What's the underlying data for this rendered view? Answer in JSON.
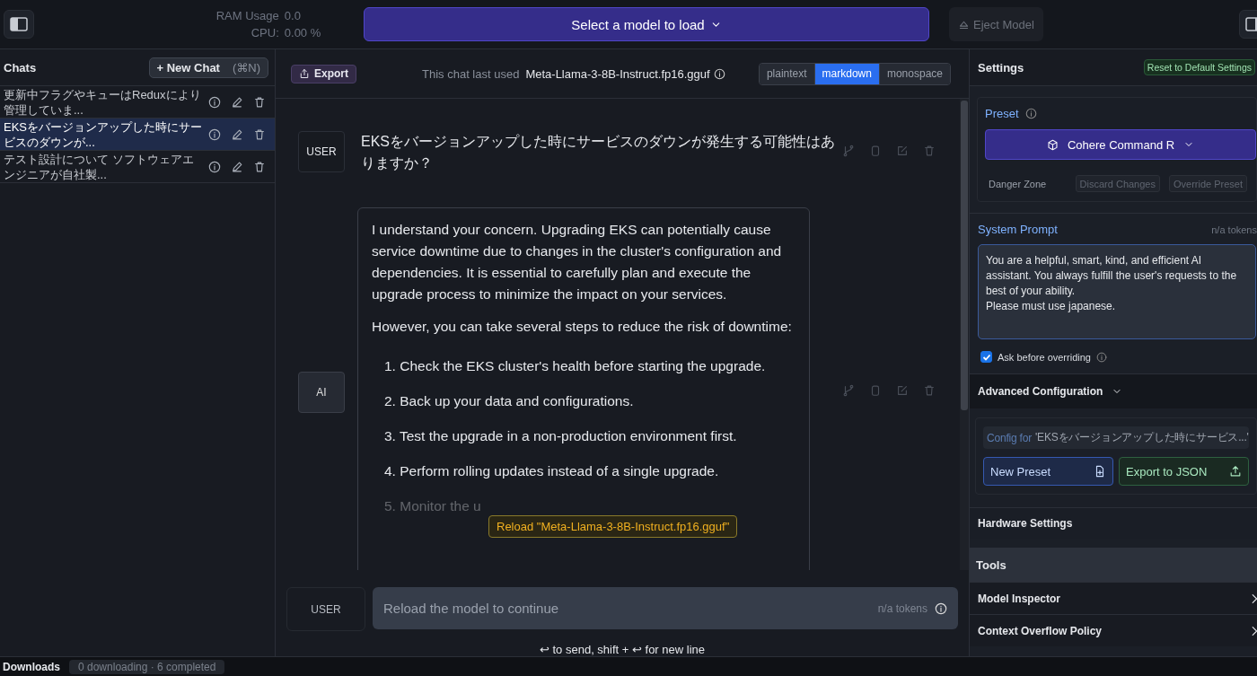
{
  "top_bar": {
    "ram_label": "RAM Usage",
    "ram_value": "0.0",
    "cpu_label": "CPU:",
    "cpu_value": "0.00 %",
    "model_select": "Select a model to load",
    "eject": {
      "label": "Eject Model",
      "disabled": true
    }
  },
  "sidebar": {
    "title": "Chats",
    "new_chat": "+ New Chat",
    "shortcut": "(⌘N)",
    "items": [
      {
        "text": "更新中フラグやキューはReduxにより管理していま...",
        "selected": false
      },
      {
        "text": "EKSをバージョンアップした時にサービスのダウンが...",
        "selected": true
      },
      {
        "text": "テスト設計について ソフトウェアエンジニアが自社製...",
        "selected": false
      }
    ]
  },
  "chat": {
    "export": "Export",
    "last_used_label": "This chat last used",
    "last_used_model": "Meta-Llama-3-8B-Instruct.fp16.gguf",
    "formats": [
      {
        "label": "plaintext",
        "selected": false
      },
      {
        "label": "markdown",
        "selected": true
      },
      {
        "label": "monospace",
        "selected": false
      }
    ],
    "messages": [
      {
        "role": "USER",
        "kind": "user",
        "text": "EKSをバージョンアップした時にサービスのダウンが発生する可能性はありますか？"
      },
      {
        "role": "AI",
        "kind": "assistant",
        "paragraphs": [
          "I understand your concern. Upgrading EKS can potentially cause service downtime due to changes in the cluster's configuration and dependencies. It is essential to carefully plan and execute the upgrade process to minimize the impact on your services.",
          "However, you can take several steps to reduce the risk of downtime:"
        ],
        "steps": [
          {
            "number": "1.",
            "text": "Check the EKS cluster's health before starting the upgrade."
          },
          {
            "number": "2.",
            "text": "Back up your data and configurations."
          },
          {
            "number": "3.",
            "text": "Test the upgrade in a non-production environment first."
          },
          {
            "number": "4.",
            "text": "Perform rolling updates instead of a single upgrade."
          },
          {
            "number": "5.",
            "text": "Monitor the u"
          }
        ]
      }
    ],
    "tooltip": "Reload \"Meta-Llama-3-8B-Instruct.fp16.gguf\"",
    "composer": {
      "role": "USER",
      "placeholder": "Reload the model to continue",
      "tokens": "n/a tokens"
    },
    "hint": "↩ to send, shift + ↩ for new line"
  },
  "settings": {
    "title": "Settings",
    "reset": "Reset to Default Settings",
    "preset_label": "Preset",
    "preset_value": "Cohere Command R",
    "danger_zone": "Danger Zone",
    "discard": "Discard Changes",
    "override": "Override Preset",
    "system_prompt_label": "System Prompt",
    "system_prompt_tokens": "n/a tokens",
    "system_prompt": "You are a helpful, smart, kind, and efficient AI assistant. You always fulfill the user's requests to the best of your ability.\nPlease must use japanese.",
    "ask_before_overriding": {
      "label": "Ask before overriding",
      "checked": true
    },
    "advanced": {
      "label": "Advanced Configuration",
      "expanded": true,
      "config_for_label": "Config for",
      "config_for_value": "'EKSをバージョンアップした時にサービス...'",
      "new_preset": "New Preset",
      "export_json": "Export to JSON"
    },
    "hardware": "Hardware Settings",
    "tools_title": "Tools",
    "tools": [
      "Model Inspector",
      "Context Overflow Policy"
    ]
  },
  "downloads": {
    "title": "Downloads",
    "status": "0 downloading · 6 completed"
  }
}
